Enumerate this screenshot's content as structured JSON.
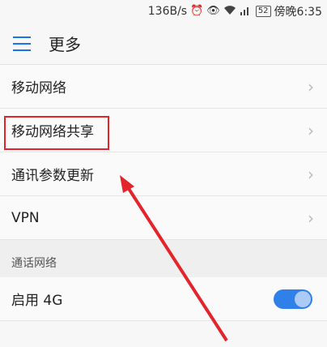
{
  "status_bar": {
    "speed": "136B/s",
    "battery": "52",
    "time": "傍晚6:35",
    "icons": [
      "alarm-icon",
      "eye-icon",
      "wifi-icon",
      "signal-icon",
      "battery-icon"
    ]
  },
  "header": {
    "title": "更多",
    "menu_icon": "menu-icon"
  },
  "items": [
    {
      "label": "移动网络"
    },
    {
      "label": "移动网络共享"
    },
    {
      "label": "通讯参数更新"
    },
    {
      "label": "VPN"
    }
  ],
  "section": {
    "title": "通话网络"
  },
  "toggle_row": {
    "label": "启用 4G",
    "enabled": true
  },
  "colors": {
    "accent": "#1a73e8",
    "highlight": "#e3242b"
  }
}
